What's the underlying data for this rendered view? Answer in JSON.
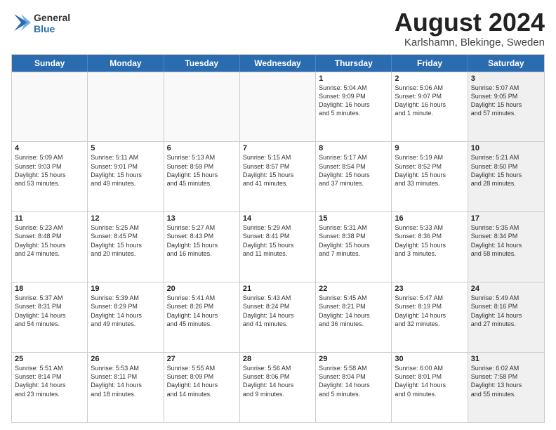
{
  "logo": {
    "general": "General",
    "blue": "Blue"
  },
  "title": "August 2024",
  "subtitle": "Karlshamn, Blekinge, Sweden",
  "weekdays": [
    "Sunday",
    "Monday",
    "Tuesday",
    "Wednesday",
    "Thursday",
    "Friday",
    "Saturday"
  ],
  "weeks": [
    [
      {
        "day": "",
        "text": "",
        "shaded": false,
        "empty": true
      },
      {
        "day": "",
        "text": "",
        "shaded": false,
        "empty": true
      },
      {
        "day": "",
        "text": "",
        "shaded": false,
        "empty": true
      },
      {
        "day": "",
        "text": "",
        "shaded": false,
        "empty": true
      },
      {
        "day": "1",
        "text": "Sunrise: 5:04 AM\nSunset: 9:09 PM\nDaylight: 16 hours\nand 5 minutes.",
        "shaded": false,
        "empty": false
      },
      {
        "day": "2",
        "text": "Sunrise: 5:06 AM\nSunset: 9:07 PM\nDaylight: 16 hours\nand 1 minute.",
        "shaded": false,
        "empty": false
      },
      {
        "day": "3",
        "text": "Sunrise: 5:07 AM\nSunset: 9:05 PM\nDaylight: 15 hours\nand 57 minutes.",
        "shaded": true,
        "empty": false
      }
    ],
    [
      {
        "day": "4",
        "text": "Sunrise: 5:09 AM\nSunset: 9:03 PM\nDaylight: 15 hours\nand 53 minutes.",
        "shaded": false,
        "empty": false
      },
      {
        "day": "5",
        "text": "Sunrise: 5:11 AM\nSunset: 9:01 PM\nDaylight: 15 hours\nand 49 minutes.",
        "shaded": false,
        "empty": false
      },
      {
        "day": "6",
        "text": "Sunrise: 5:13 AM\nSunset: 8:59 PM\nDaylight: 15 hours\nand 45 minutes.",
        "shaded": false,
        "empty": false
      },
      {
        "day": "7",
        "text": "Sunrise: 5:15 AM\nSunset: 8:57 PM\nDaylight: 15 hours\nand 41 minutes.",
        "shaded": false,
        "empty": false
      },
      {
        "day": "8",
        "text": "Sunrise: 5:17 AM\nSunset: 8:54 PM\nDaylight: 15 hours\nand 37 minutes.",
        "shaded": false,
        "empty": false
      },
      {
        "day": "9",
        "text": "Sunrise: 5:19 AM\nSunset: 8:52 PM\nDaylight: 15 hours\nand 33 minutes.",
        "shaded": false,
        "empty": false
      },
      {
        "day": "10",
        "text": "Sunrise: 5:21 AM\nSunset: 8:50 PM\nDaylight: 15 hours\nand 28 minutes.",
        "shaded": true,
        "empty": false
      }
    ],
    [
      {
        "day": "11",
        "text": "Sunrise: 5:23 AM\nSunset: 8:48 PM\nDaylight: 15 hours\nand 24 minutes.",
        "shaded": false,
        "empty": false
      },
      {
        "day": "12",
        "text": "Sunrise: 5:25 AM\nSunset: 8:45 PM\nDaylight: 15 hours\nand 20 minutes.",
        "shaded": false,
        "empty": false
      },
      {
        "day": "13",
        "text": "Sunrise: 5:27 AM\nSunset: 8:43 PM\nDaylight: 15 hours\nand 16 minutes.",
        "shaded": false,
        "empty": false
      },
      {
        "day": "14",
        "text": "Sunrise: 5:29 AM\nSunset: 8:41 PM\nDaylight: 15 hours\nand 11 minutes.",
        "shaded": false,
        "empty": false
      },
      {
        "day": "15",
        "text": "Sunrise: 5:31 AM\nSunset: 8:38 PM\nDaylight: 15 hours\nand 7 minutes.",
        "shaded": false,
        "empty": false
      },
      {
        "day": "16",
        "text": "Sunrise: 5:33 AM\nSunset: 8:36 PM\nDaylight: 15 hours\nand 3 minutes.",
        "shaded": false,
        "empty": false
      },
      {
        "day": "17",
        "text": "Sunrise: 5:35 AM\nSunset: 8:34 PM\nDaylight: 14 hours\nand 58 minutes.",
        "shaded": true,
        "empty": false
      }
    ],
    [
      {
        "day": "18",
        "text": "Sunrise: 5:37 AM\nSunset: 8:31 PM\nDaylight: 14 hours\nand 54 minutes.",
        "shaded": false,
        "empty": false
      },
      {
        "day": "19",
        "text": "Sunrise: 5:39 AM\nSunset: 8:29 PM\nDaylight: 14 hours\nand 49 minutes.",
        "shaded": false,
        "empty": false
      },
      {
        "day": "20",
        "text": "Sunrise: 5:41 AM\nSunset: 8:26 PM\nDaylight: 14 hours\nand 45 minutes.",
        "shaded": false,
        "empty": false
      },
      {
        "day": "21",
        "text": "Sunrise: 5:43 AM\nSunset: 8:24 PM\nDaylight: 14 hours\nand 41 minutes.",
        "shaded": false,
        "empty": false
      },
      {
        "day": "22",
        "text": "Sunrise: 5:45 AM\nSunset: 8:21 PM\nDaylight: 14 hours\nand 36 minutes.",
        "shaded": false,
        "empty": false
      },
      {
        "day": "23",
        "text": "Sunrise: 5:47 AM\nSunset: 8:19 PM\nDaylight: 14 hours\nand 32 minutes.",
        "shaded": false,
        "empty": false
      },
      {
        "day": "24",
        "text": "Sunrise: 5:49 AM\nSunset: 8:16 PM\nDaylight: 14 hours\nand 27 minutes.",
        "shaded": true,
        "empty": false
      }
    ],
    [
      {
        "day": "25",
        "text": "Sunrise: 5:51 AM\nSunset: 8:14 PM\nDaylight: 14 hours\nand 23 minutes.",
        "shaded": false,
        "empty": false
      },
      {
        "day": "26",
        "text": "Sunrise: 5:53 AM\nSunset: 8:11 PM\nDaylight: 14 hours\nand 18 minutes.",
        "shaded": false,
        "empty": false
      },
      {
        "day": "27",
        "text": "Sunrise: 5:55 AM\nSunset: 8:09 PM\nDaylight: 14 hours\nand 14 minutes.",
        "shaded": false,
        "empty": false
      },
      {
        "day": "28",
        "text": "Sunrise: 5:56 AM\nSunset: 8:06 PM\nDaylight: 14 hours\nand 9 minutes.",
        "shaded": false,
        "empty": false
      },
      {
        "day": "29",
        "text": "Sunrise: 5:58 AM\nSunset: 8:04 PM\nDaylight: 14 hours\nand 5 minutes.",
        "shaded": false,
        "empty": false
      },
      {
        "day": "30",
        "text": "Sunrise: 6:00 AM\nSunset: 8:01 PM\nDaylight: 14 hours\nand 0 minutes.",
        "shaded": false,
        "empty": false
      },
      {
        "day": "31",
        "text": "Sunrise: 6:02 AM\nSunset: 7:58 PM\nDaylight: 13 hours\nand 55 minutes.",
        "shaded": true,
        "empty": false
      }
    ]
  ]
}
